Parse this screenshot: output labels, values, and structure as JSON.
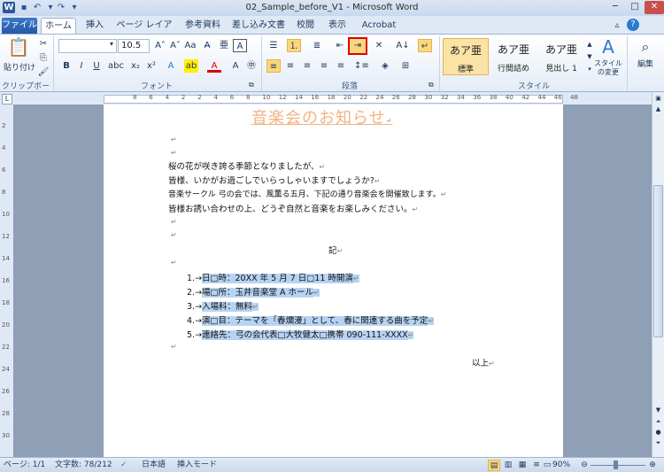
{
  "window": {
    "title": "02_Sample_before_V1 - Microsoft Word",
    "app_icon_letter": "W",
    "qat": [
      "save-icon",
      "undo-icon",
      "redo-icon",
      "customize-icon"
    ],
    "controls": {
      "minimize": "─",
      "maximize": "□",
      "close": "✕"
    }
  },
  "tabs": [
    "ファイル",
    "ホーム",
    "挿入",
    "ページ レイアウト",
    "参考資料",
    "差し込み文書",
    "校閲",
    "表示",
    "Acrobat"
  ],
  "ribbon": {
    "clipboard": {
      "paste": "貼り付け",
      "label": "クリップボード"
    },
    "font": {
      "name": "",
      "size": "10.5",
      "label": "フォント"
    },
    "paragraph": {
      "label": "段落"
    },
    "styles": {
      "label": "スタイル",
      "items": [
        {
          "sample": "あア亜",
          "name": "標準"
        },
        {
          "sample": "あア亜",
          "name": "行間詰め"
        },
        {
          "sample": "あア亜",
          "name": "見出し 1"
        }
      ],
      "change": "スタイルの変更"
    },
    "editing": {
      "label": "編集"
    }
  },
  "ruler": {
    "ticks": [
      "8",
      "6",
      "4",
      "2",
      "2",
      "4",
      "6",
      "8",
      "10",
      "12",
      "14",
      "16",
      "18",
      "20",
      "22",
      "24",
      "26",
      "28",
      "30",
      "32",
      "34",
      "36",
      "38",
      "40",
      "42",
      "44",
      "46",
      "48"
    ]
  },
  "vruler": {
    "ticks": [
      "2",
      "4",
      "6",
      "8",
      "10",
      "12",
      "14",
      "16",
      "18",
      "20",
      "22",
      "24",
      "26",
      "28",
      "30"
    ]
  },
  "document": {
    "title": "音楽会のお知らせ",
    "para": "↵",
    "body": [
      "桜の花が咲き誇る季節となりましたが、",
      "皆様、いかがお過ごしでいらっしゃいますでしょうか?",
      "音楽サークル 弓の会では、風薫る五月、下記の通り音楽会を開催致します。",
      "皆様お誘い合わせの上、どうぞ自然と音楽をお楽しみください。"
    ],
    "ki": "記",
    "list": [
      {
        "num": "1.→",
        "text": "日□時：20XX 年 5 月 7 日□11 時開演"
      },
      {
        "num": "2.→",
        "text": "場□所：玉井音楽堂 A ホール"
      },
      {
        "num": "3.→",
        "text": "入場料：無料"
      },
      {
        "num": "4.→",
        "text": "演□目：テーマを「春爛漫」として、春に関連する曲を予定"
      },
      {
        "num": "5.→",
        "text": "連絡先：弓の会代表□大牧健太□携帯 090-111-XXXX"
      }
    ],
    "ijou": "以上"
  },
  "status": {
    "page": "ページ: 1/1",
    "words": "文字数: 78/212",
    "language": "日本語",
    "mode": "挿入モード",
    "zoom": "90%"
  },
  "colors": {
    "accent": "#2b579a",
    "highlight": "#b7d3f3",
    "title_text": "#f4b183",
    "red_box": "#e00000"
  }
}
